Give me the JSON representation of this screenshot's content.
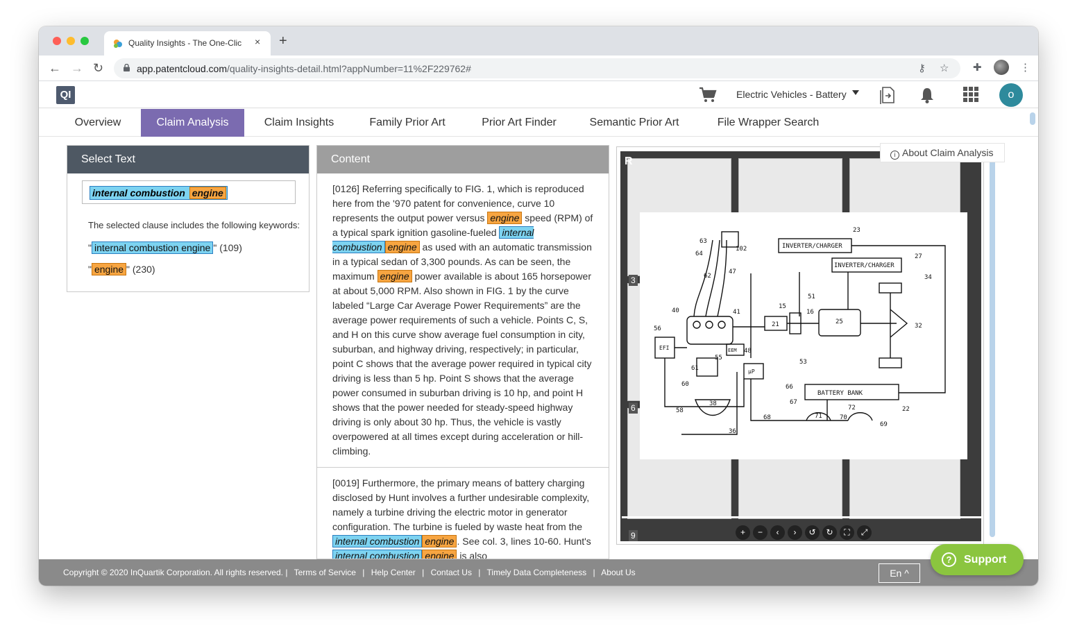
{
  "browser": {
    "tab_title": "Quality Insights - The One-Clic",
    "tab_close": "×",
    "new_tab": "+",
    "url_host": "app.patentcloud.com",
    "url_path": "/quality-insights-detail.html?appNumber=11%2F229762#"
  },
  "header": {
    "logo": "QI",
    "workspace": "Electric Vehicles - Battery",
    "avatar": "o"
  },
  "nav": {
    "tabs": [
      {
        "label": "Overview"
      },
      {
        "label": "Claim Analysis"
      },
      {
        "label": "Claim Insights"
      },
      {
        "label": "Family Prior Art"
      },
      {
        "label": "Prior Art Finder"
      },
      {
        "label": "Semantic Prior Art"
      },
      {
        "label": "File Wrapper Search"
      }
    ],
    "active": "Claim Analysis"
  },
  "select_panel": {
    "title": "Select Text",
    "selected_part1": "internal combustion",
    "selected_part2": "engine",
    "intro": "The selected clause includes the following keywords:",
    "keywords": [
      {
        "term": "internal combustion engine",
        "count": "(109)"
      },
      {
        "term": "engine",
        "count": "(230)"
      }
    ]
  },
  "content_panel": {
    "title": "Content",
    "p1": {
      "t1": "[0126] Referring specifically to FIG. 1, which is reproduced here from the '970 patent for convenience, curve 10 represents the output power versus ",
      "h1": "engine",
      "t2": " speed (RPM) of a typical spark ignition gasoline-fueled ",
      "h2a": "internal combustion",
      "h2b": "engine",
      "t3": " as used with an automatic transmission in a typical sedan of 3,300 pounds. As can be seen, the maximum ",
      "h3": "engine",
      "t4": " power available is about 165 horsepower at about 5,000 RPM. Also shown in FIG. 1 by the curve labeled “Large Car Average Power Requirements” are the average power requirements of such a vehicle. Points C, S, and H on this curve show average fuel consumption in city, suburban, and highway driving, respectively; in particular, point C shows that the average power required in typical city driving is less than 5 hp. Point S shows that the average power consumed in suburban driving is 10 hp, and point H shows that the power needed for steady-speed highway driving is only about 30 hp. Thus, the vehicle is vastly overpowered at all times except during acceleration or hill-climbing."
    },
    "p2": {
      "t1": "[0019] Furthermore, the primary means of battery charging disclosed by Hunt involves a further undesirable complexity, namely a turbine driving the electric motor in generator configuration. The turbine is fueled by waste heat from the ",
      "h1a": "internal combustion",
      "h1b": "engine",
      "t2": ". See col. 3, lines 10-60. Hunt's ",
      "h2a": "internal combustion",
      "h2b": "engine",
      "t3": " is also"
    }
  },
  "viewer": {
    "corner_label": "R",
    "page_numbers": [
      "3",
      "6",
      "9"
    ],
    "drawing_labels": [
      "INVERTER/CHARGER",
      "INVERTER/CHARGER",
      "BATTERY BANK",
      "EFI",
      "EEM",
      "μP",
      "63",
      "64",
      "62",
      "102",
      "47",
      "23",
      "27",
      "34",
      "40",
      "41",
      "15",
      "51",
      "16",
      "21",
      "25",
      "32",
      "56",
      "55",
      "48",
      "53",
      "61",
      "60",
      "58",
      "38",
      "36",
      "66",
      "67",
      "68",
      "71",
      "72",
      "70",
      "69",
      "22"
    ],
    "controls": [
      "+",
      "−",
      "‹",
      "›",
      "↺",
      "↻",
      "⛶",
      "⤢"
    ]
  },
  "about_link": "About Claim Analysis",
  "footer": {
    "copyright": "Copyright © 2020 InQuartik Corporation. All rights reserved. |",
    "links": [
      "Terms of Service",
      "Help Center",
      "Contact Us",
      "Timely Data Completeness",
      "About Us"
    ],
    "separator": "|",
    "language": "En"
  },
  "support": "Support",
  "colors": {
    "active_tab": "#7b6bb0",
    "highlight_blue": "#7dd3f1",
    "highlight_orange": "#f7a541",
    "support_green": "#8bc53f"
  }
}
